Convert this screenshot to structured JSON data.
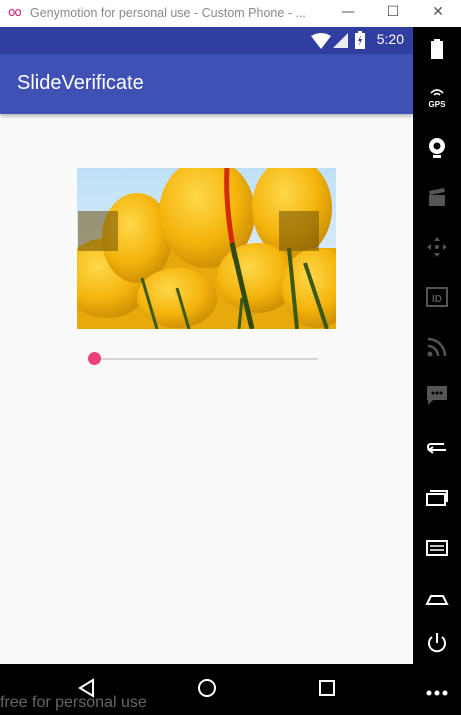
{
  "window": {
    "title": "Genymotion for personal use - Custom Phone - ...",
    "logo_glyph": "oo",
    "minimize": "—",
    "maximize": "☐",
    "close": "✕"
  },
  "statusbar": {
    "time": "5:20"
  },
  "app": {
    "title": "SlideVerificate"
  },
  "slider": {
    "progress": 0.0
  },
  "watermark": "free for personal use",
  "sidebar": {
    "gps_label": "GPS",
    "id_label": "ID",
    "icons": [
      "battery-icon",
      "gps-icon",
      "camera-icon",
      "clapper-icon",
      "dpad-icon",
      "id-icon",
      "rss-icon",
      "sms-icon",
      "back-icon",
      "recents-icon",
      "menu-icon",
      "home-icon",
      "power-icon",
      "more-icon"
    ]
  },
  "colors": {
    "primary": "#3f51b5",
    "primary_dark": "#303f9f",
    "accent": "#ec407a"
  }
}
